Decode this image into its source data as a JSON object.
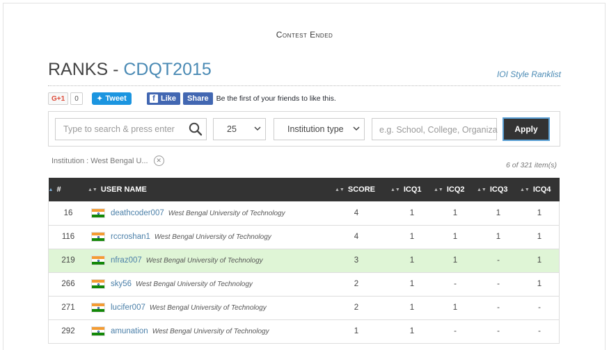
{
  "contest_status": "Contest Ended",
  "title": {
    "prefix": "RANKS - ",
    "code": "CDQT2015"
  },
  "ioi_link": "IOI Style Ranklist",
  "social": {
    "gplus_label": "G+1",
    "gplus_count": "0",
    "tweet_label": "Tweet",
    "fb_like": "Like",
    "fb_share": "Share",
    "fb_text": "Be the first of your friends to like this."
  },
  "filters": {
    "search_placeholder": "Type to search & press enter",
    "per_page": "25",
    "institution_type": "Institution type",
    "institution_placeholder": "e.g. School, College, Organiza",
    "apply_label": "Apply",
    "active_filter": "Institution : West Bengal U...",
    "items_count": "6 of 321 item(s)"
  },
  "table": {
    "headers": [
      "#",
      "USER NAME",
      "SCORE",
      "ICQ1",
      "ICQ2",
      "ICQ3",
      "ICQ4"
    ],
    "rows": [
      {
        "rank": "16",
        "user": "deathcoder007",
        "institution": "West Bengal University of Technology",
        "score": "4",
        "icq1": "1",
        "icq2": "1",
        "icq3": "1",
        "icq4": "1",
        "highlight": false
      },
      {
        "rank": "116",
        "user": "rccroshan1",
        "institution": "West Bengal University of Technology",
        "score": "4",
        "icq1": "1",
        "icq2": "1",
        "icq3": "1",
        "icq4": "1",
        "highlight": false
      },
      {
        "rank": "219",
        "user": "nfraz007",
        "institution": "West Bengal University of Technology",
        "score": "3",
        "icq1": "1",
        "icq2": "1",
        "icq3": "-",
        "icq4": "1",
        "highlight": true
      },
      {
        "rank": "266",
        "user": "sky56",
        "institution": "West Bengal University of Technology",
        "score": "2",
        "icq1": "1",
        "icq2": "-",
        "icq3": "-",
        "icq4": "1",
        "highlight": false
      },
      {
        "rank": "271",
        "user": "lucifer007",
        "institution": "West Bengal University of Technology",
        "score": "2",
        "icq1": "1",
        "icq2": "1",
        "icq3": "-",
        "icq4": "-",
        "highlight": false
      },
      {
        "rank": "292",
        "user": "amunation",
        "institution": "West Bengal University of Technology",
        "score": "1",
        "icq1": "1",
        "icq2": "-",
        "icq3": "-",
        "icq4": "-",
        "highlight": false
      }
    ]
  },
  "colors": {
    "accent": "#4a8ab4",
    "header_bg": "#333333",
    "highlight_row": "#dff5d6",
    "tweet": "#1b95e0",
    "facebook": "#4267b2"
  },
  "icons": {
    "search": "search-icon",
    "clear_filter": "close-circle-icon",
    "flag": "india-flag-icon"
  }
}
